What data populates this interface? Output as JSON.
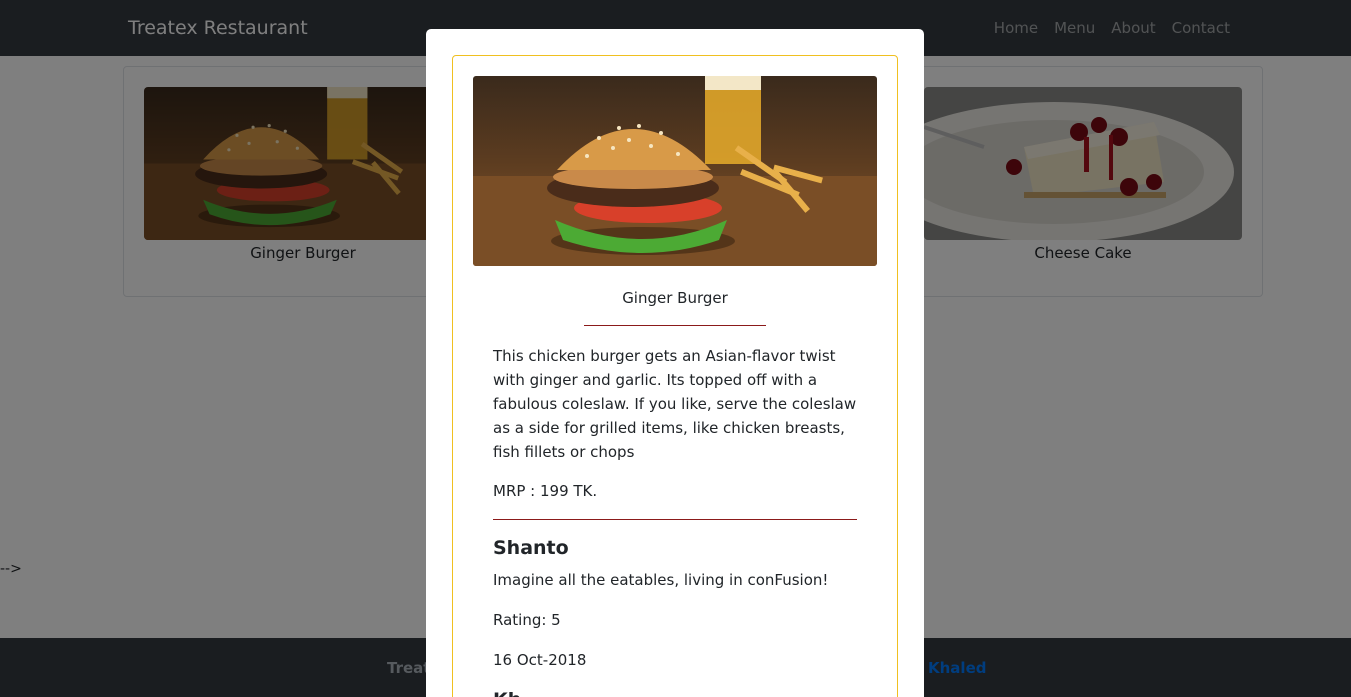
{
  "navbar": {
    "brand": "Treatex Restaurant",
    "links": [
      "Home",
      "Menu",
      "About",
      "Contact"
    ]
  },
  "menu": {
    "dishes": [
      {
        "name": "Ginger Burger",
        "image_icon": "burger-photo"
      },
      {
        "name": "Cheese Cake",
        "image_icon": "cheesecake-photo"
      }
    ]
  },
  "stray_text": "-->",
  "footer": {
    "text": "Treat",
    "author": "Khaled"
  },
  "modal": {
    "dish_name": "Ginger Burger",
    "description": "This chicken burger gets an Asian-flavor twist with ginger and garlic. Its topped off with a fabulous coleslaw. If you like, serve the coleslaw as a side for grilled items, like chicken breasts, fish fillets or chops",
    "price": "MRP : 199 TK.",
    "review": {
      "author": "Shanto",
      "comment": "Imagine all the eatables, living in conFusion!",
      "rating": "Rating: 5",
      "date": "16 Oct-2018"
    },
    "next_review_author": "Kh..."
  },
  "colors": {
    "navbar": "#343a40",
    "card_border": "#f0c020",
    "rule": "#8b1a1a",
    "link": "#007bff"
  }
}
